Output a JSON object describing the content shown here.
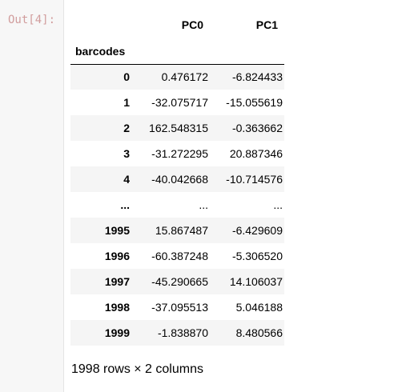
{
  "prompt": {
    "label": "Out[4]:"
  },
  "table": {
    "columns": [
      "PC0",
      "PC1"
    ],
    "index_name": "barcodes",
    "rows": [
      {
        "index": "0",
        "values": [
          "0.476172",
          "-6.824433"
        ]
      },
      {
        "index": "1",
        "values": [
          "-32.075717",
          "-15.055619"
        ]
      },
      {
        "index": "2",
        "values": [
          "162.548315",
          "-0.363662"
        ]
      },
      {
        "index": "3",
        "values": [
          "-31.272295",
          "20.887346"
        ]
      },
      {
        "index": "4",
        "values": [
          "-40.042668",
          "-10.714576"
        ]
      },
      {
        "index": "...",
        "values": [
          "...",
          "..."
        ]
      },
      {
        "index": "1995",
        "values": [
          "15.867487",
          "-6.429609"
        ]
      },
      {
        "index": "1996",
        "values": [
          "-60.387248",
          "-5.306520"
        ]
      },
      {
        "index": "1997",
        "values": [
          "-45.290665",
          "14.106037"
        ]
      },
      {
        "index": "1998",
        "values": [
          "-37.095513",
          "5.046188"
        ]
      },
      {
        "index": "1999",
        "values": [
          "-1.838870",
          "8.480566"
        ]
      }
    ]
  },
  "shape": {
    "text": "1998 rows × 2 columns"
  }
}
